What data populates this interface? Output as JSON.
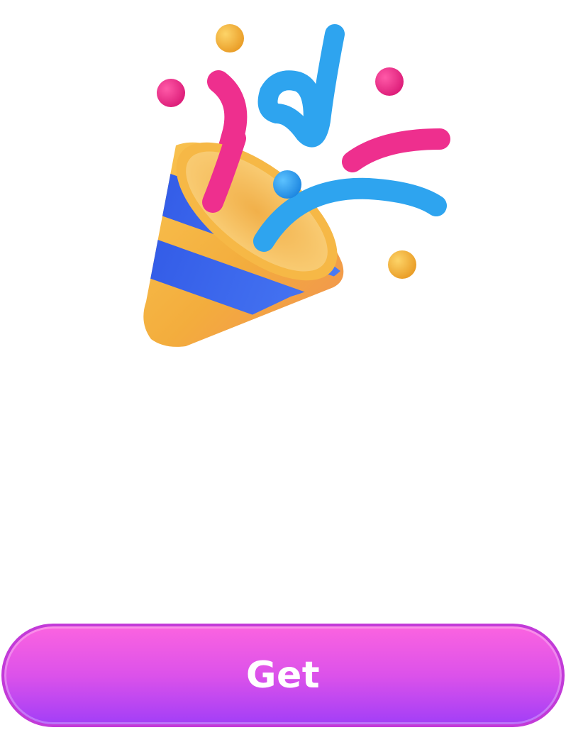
{
  "illustration": {
    "icon": "party-popper-icon",
    "colors": {
      "cone_yellow": "#f3b73f",
      "cone_stripe": "#3f6df2",
      "confetti_pink": "#ee2f8e",
      "confetti_blue": "#2ea4ef",
      "confetti_gold": "#f5b83a"
    }
  },
  "button": {
    "label": "Get",
    "gradient_top": "#fb63e0",
    "gradient_bottom": "#a23ef7",
    "border": "#c23ad8"
  }
}
